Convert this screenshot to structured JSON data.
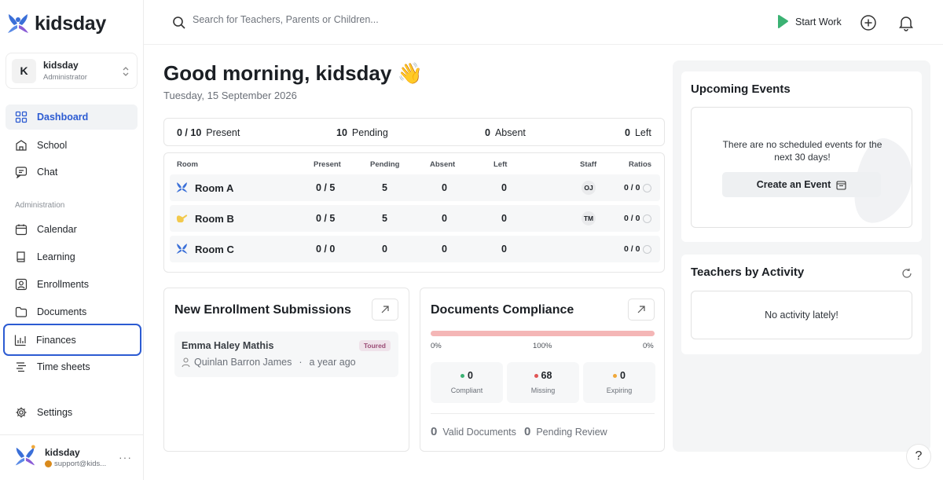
{
  "brand": {
    "name": "kidsday"
  },
  "org": {
    "initial": "K",
    "name": "kidsday",
    "role": "Administrator"
  },
  "nav": {
    "dashboard": "Dashboard",
    "school": "School",
    "chat": "Chat",
    "section_admin": "Administration",
    "calendar": "Calendar",
    "learning": "Learning",
    "enrollments": "Enrollments",
    "documents": "Documents",
    "finances": "Finances",
    "timesheets": "Time sheets",
    "settings": "Settings"
  },
  "user": {
    "name": "kidsday",
    "email": "support@kids..."
  },
  "topbar": {
    "search_placeholder": "Search for Teachers, Parents or Children...",
    "start_work": "Start Work"
  },
  "greeting": {
    "title": "Good morning, kidsday 👋",
    "date": "Tuesday, 15 September 2026"
  },
  "summary": {
    "present_value": "0 / 10",
    "present_label": "Present",
    "pending_value": "10",
    "pending_label": "Pending",
    "absent_value": "0",
    "absent_label": "Absent",
    "left_value": "0",
    "left_label": "Left"
  },
  "rooms_table": {
    "headers": {
      "room": "Room",
      "present": "Present",
      "pending": "Pending",
      "absent": "Absent",
      "left": "Left",
      "staff": "Staff",
      "ratios": "Ratios"
    },
    "rows": [
      {
        "name": "Room A",
        "present": "0 / 5",
        "pending": "5",
        "absent": "0",
        "left": "0",
        "staff": "OJ",
        "ratio": "0 / 0",
        "icon": "kidsday-logo-icon",
        "icon_color": "#3a6fd8"
      },
      {
        "name": "Room B",
        "present": "0 / 5",
        "pending": "5",
        "absent": "0",
        "left": "0",
        "staff": "TM",
        "ratio": "0 / 0",
        "icon": "hand-icon",
        "icon_color": "#f2c94c"
      },
      {
        "name": "Room C",
        "present": "0 / 0",
        "pending": "0",
        "absent": "0",
        "left": "0",
        "staff": "",
        "ratio": "0 / 0",
        "icon": "kidsday-logo-icon",
        "icon_color": "#3a6fd8"
      }
    ]
  },
  "enrollments_card": {
    "title": "New Enrollment Submissions",
    "item": {
      "child": "Emma Haley Mathis",
      "badge": "Toured",
      "parent": "Quinlan Barron James",
      "separator": "·",
      "time": "a year ago"
    }
  },
  "documents_card": {
    "title": "Documents Compliance",
    "compliance_percent": 100,
    "bar_labels": [
      "0%",
      "100%",
      "0%"
    ],
    "stats": [
      {
        "value": "0",
        "label": "Compliant",
        "color": "#3bb273"
      },
      {
        "value": "68",
        "label": "Missing",
        "color": "#e05555"
      },
      {
        "value": "0",
        "label": "Expiring",
        "color": "#f0a83a"
      }
    ],
    "valid_value": "0",
    "valid_label": "Valid Documents",
    "pending_value": "0",
    "pending_label": "Pending Review"
  },
  "events_card": {
    "title": "Upcoming Events",
    "empty_message": "There are no scheduled events for the next 30 days!",
    "create_label": "Create an Event"
  },
  "activity_card": {
    "title": "Teachers by Activity",
    "empty_message": "No activity lately!"
  },
  "help": {
    "label": "?"
  },
  "colors": {
    "accent": "#2c5bd2",
    "start_work_green": "#3bb273",
    "logo_blue": "#3a6fd8",
    "logo_purple": "#8a5cd6"
  }
}
